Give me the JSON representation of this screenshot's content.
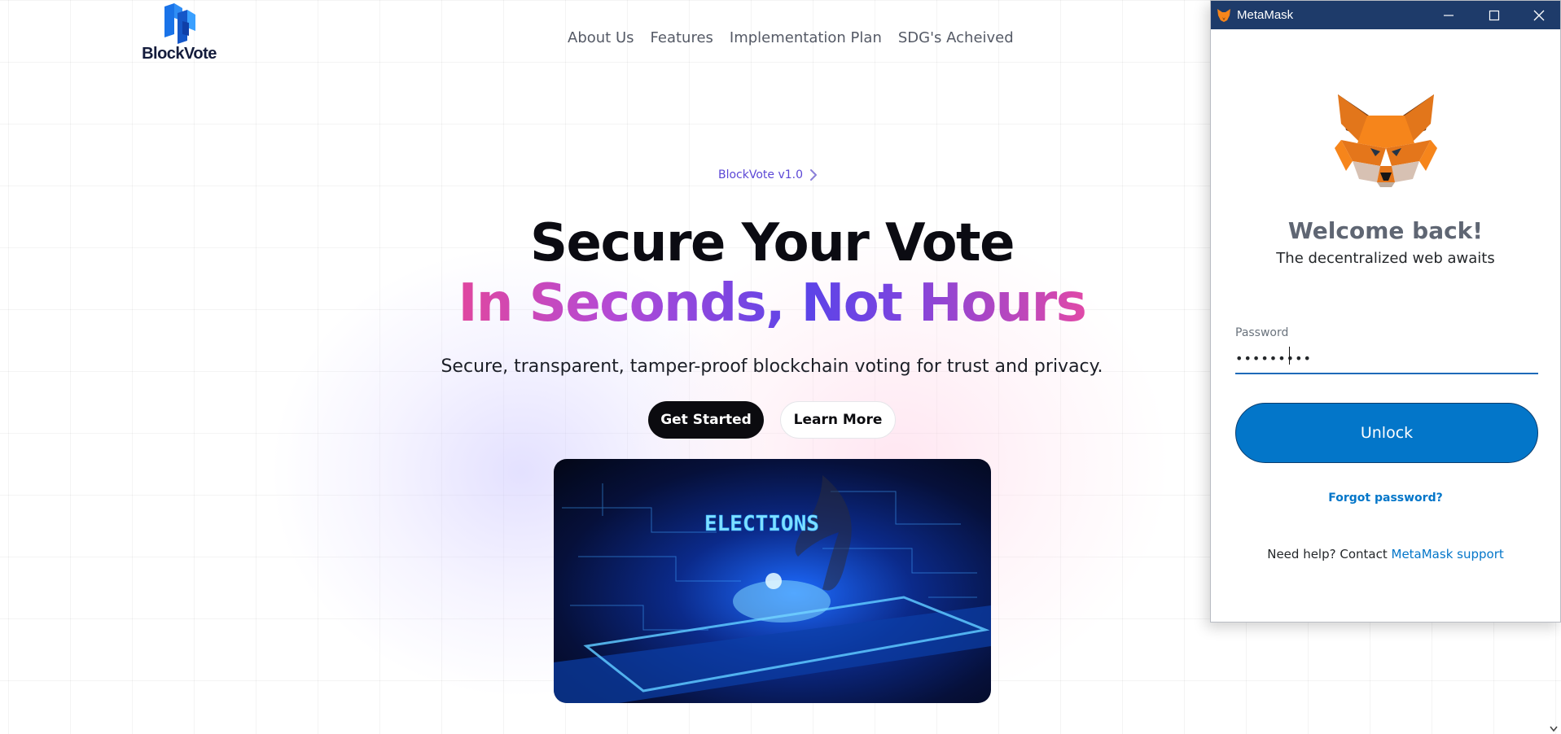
{
  "site": {
    "logo_text": "BlockVote",
    "nav": [
      {
        "label": "About Us"
      },
      {
        "label": "Features"
      },
      {
        "label": "Implementation Plan"
      },
      {
        "label": "SDG's Acheived"
      }
    ],
    "version_badge": "BlockVote v1.0",
    "headline_line1": "Secure Your Vote",
    "headline_line2": "In Seconds, Not Hours",
    "subheadline": "Secure, transparent, tamper-proof blockchain voting for trust and privacy.",
    "primary_button": "Get Started",
    "secondary_button": "Learn More",
    "hero_image_text": "ELECTIONS",
    "colors": {
      "grad_pink": "#e0479f",
      "grad_purple": "#5b44e8",
      "version_text": "#5b47d6"
    }
  },
  "metamask": {
    "window_title": "MetaMask",
    "window_icons": [
      "minimize-icon",
      "maximize-icon",
      "close-icon"
    ],
    "welcome": "Welcome back!",
    "tagline": "The decentralized web awaits",
    "password_label": "Password",
    "password_value": "•••••••••",
    "unlock_button": "Unlock",
    "forgot_password": "Forgot password?",
    "help_text": "Need help? Contact",
    "help_link": "MetaMask support",
    "colors": {
      "titlebar": "#1e3b6a",
      "button": "#0376c9",
      "link": "#0376c9"
    }
  }
}
